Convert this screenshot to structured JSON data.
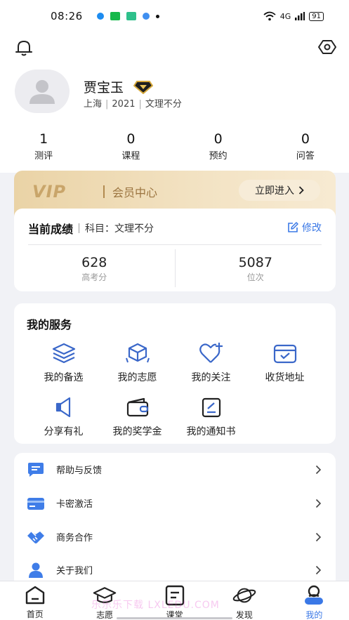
{
  "status_bar": {
    "time": "08:26",
    "network": "4G",
    "battery": "91"
  },
  "profile": {
    "name": "贾宝玉",
    "meta": [
      "上海",
      "2021",
      "文理不分"
    ]
  },
  "stats": [
    {
      "value": "1",
      "label": "测评"
    },
    {
      "value": "0",
      "label": "课程"
    },
    {
      "value": "0",
      "label": "预约"
    },
    {
      "value": "0",
      "label": "问答"
    }
  ],
  "vip": {
    "logo": "VIP",
    "title": "会员中心",
    "button": "立即进入"
  },
  "score": {
    "title": "当前成绩",
    "subject": "科目：文理不分",
    "edit": "修改",
    "items": [
      {
        "value": "628",
        "label": "高考分"
      },
      {
        "value": "5087",
        "label": "位次"
      }
    ]
  },
  "services": {
    "title": "我的服务",
    "items": [
      {
        "label": "我的备选",
        "icon": "layers-icon"
      },
      {
        "label": "我的志愿",
        "icon": "box-icon"
      },
      {
        "label": "我的关注",
        "icon": "heart-plus-icon"
      },
      {
        "label": "收货地址",
        "icon": "inbox-check-icon"
      },
      {
        "label": "分享有礼",
        "icon": "megaphone-icon"
      },
      {
        "label": "我的奖学金",
        "icon": "wallet-icon"
      },
      {
        "label": "我的通知书",
        "icon": "notice-icon"
      }
    ]
  },
  "menu": [
    {
      "label": "帮助与反馈",
      "icon": "chat-icon"
    },
    {
      "label": "卡密激活",
      "icon": "card-icon"
    },
    {
      "label": "商务合作",
      "icon": "handshake-icon"
    },
    {
      "label": "关于我们",
      "icon": "person-icon"
    }
  ],
  "tabs": [
    {
      "label": "首页",
      "icon": "home-icon"
    },
    {
      "label": "志愿",
      "icon": "graduation-cap-icon"
    },
    {
      "label": "课堂",
      "icon": "document-icon"
    },
    {
      "label": "发现",
      "icon": "planet-icon"
    },
    {
      "label": "我的",
      "icon": "user-icon",
      "active": true
    }
  ],
  "watermark": "乐乐乐下载 LXLEDU.COM",
  "colors": {
    "accent": "#3a78e6",
    "vip_text": "#9b7440",
    "vip_gold": "#c9a56a",
    "page_bg": "#f1f2f6"
  }
}
